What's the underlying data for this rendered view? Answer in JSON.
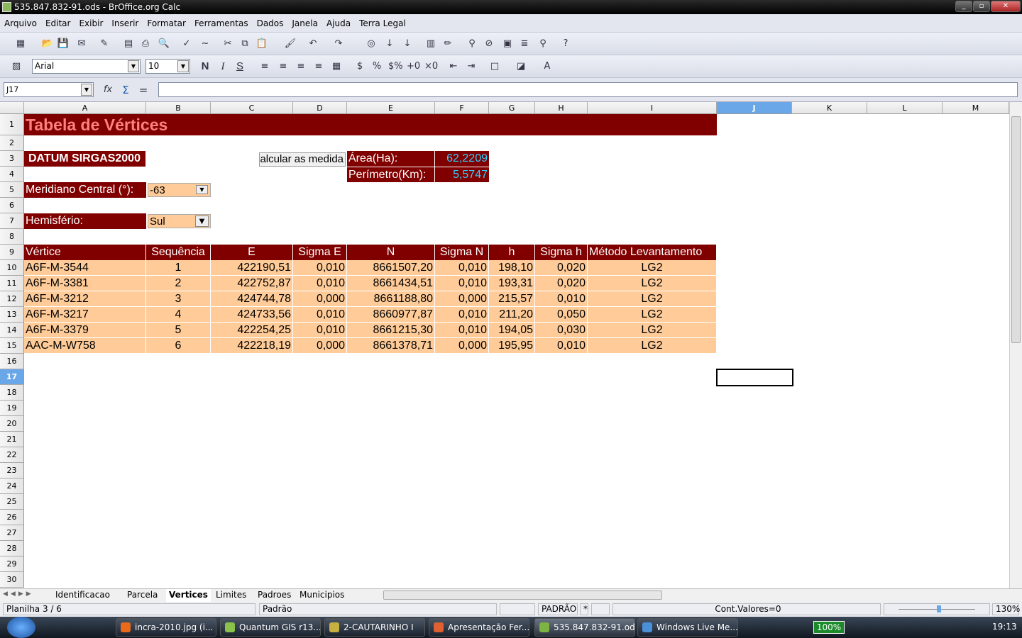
{
  "window": {
    "title": "535.847.832-91.ods - BrOffice.org Calc"
  },
  "menu": [
    "Arquivo",
    "Editar",
    "Exibir",
    "Inserir",
    "Formatar",
    "Ferramentas",
    "Dados",
    "Janela",
    "Ajuda",
    "Terra Legal"
  ],
  "format": {
    "font": "Arial",
    "size": "10",
    "bold": "N",
    "italic": "I",
    "underline": "S"
  },
  "formula": {
    "cell_ref": "J17",
    "value": ""
  },
  "columns": [
    "A",
    "B",
    "C",
    "D",
    "E",
    "F",
    "G",
    "H",
    "I",
    "J",
    "K",
    "L",
    "M"
  ],
  "rows": [
    "1",
    "2",
    "3",
    "4",
    "5",
    "6",
    "7",
    "8",
    "9",
    "10",
    "11",
    "12",
    "13",
    "14",
    "15",
    "16",
    "17",
    "18",
    "19",
    "20",
    "21",
    "22",
    "23",
    "24",
    "25",
    "26",
    "27",
    "28",
    "29",
    "30"
  ],
  "selected": {
    "column": "J",
    "row": "17"
  },
  "sheet": {
    "title": "Tabela de Vértices",
    "datum": "DATUM SIRGAS2000",
    "calc_button": "alcular as medida",
    "area_label": "Área(Ha):",
    "area_value": "62,2209",
    "perimeter_label": "Perímetro(Km):",
    "perimeter_value": "5,5747",
    "meridian_label": "Meridiano Central (°):",
    "meridian_value": "-63",
    "hemisphere_label": "Hemisfério:",
    "hemisphere_value": "Sul",
    "headers": [
      "Vértice",
      "Sequência",
      "E",
      "Sigma E",
      "N",
      "Sigma N",
      "h",
      "Sigma h",
      "Método Levantamento"
    ],
    "data": [
      [
        "A6F-M-3544",
        "1",
        "422190,51",
        "0,010",
        "8661507,20",
        "0,010",
        "198,10",
        "0,020",
        "LG2"
      ],
      [
        "A6F-M-3381",
        "2",
        "422752,87",
        "0,010",
        "8661434,51",
        "0,010",
        "193,31",
        "0,020",
        "LG2"
      ],
      [
        "A6F-M-3212",
        "3",
        "424744,78",
        "0,000",
        "8661188,80",
        "0,000",
        "215,57",
        "0,010",
        "LG2"
      ],
      [
        "A6F-M-3217",
        "4",
        "424733,56",
        "0,010",
        "8660977,87",
        "0,010",
        "211,20",
        "0,050",
        "LG2"
      ],
      [
        "A6F-M-3379",
        "5",
        "422254,25",
        "0,010",
        "8661215,30",
        "0,010",
        "194,05",
        "0,030",
        "LG2"
      ],
      [
        "AAC-M-W758",
        "6",
        "422218,19",
        "0,000",
        "8661378,71",
        "0,000",
        "195,95",
        "0,010",
        "LG2"
      ]
    ],
    "colors": {
      "dark": "#800000",
      "peach": "#ffcc99",
      "title_text": "#ff8080",
      "value_text": "#33ccff"
    }
  },
  "tabs": [
    "Identificacao",
    "Parcela",
    "Vertices",
    "Limites",
    "Padroes",
    "Municipios"
  ],
  "active_tab": "Vertices",
  "status": {
    "sheet": "Planilha 3 / 6",
    "style": "Padrão",
    "mode": "PADRÃO",
    "modified": "*",
    "sum": "Cont.Valores=0",
    "zoom": "130%"
  },
  "taskbar": {
    "items": [
      "incra-2010.jpg (i...",
      "Quantum GIS r13...",
      "2-CAUTARINHO I",
      "Apresentação Fer...",
      "535.847.832-91.od...",
      "Windows Live Me..."
    ],
    "battery": "100%",
    "clock": "19:13"
  }
}
